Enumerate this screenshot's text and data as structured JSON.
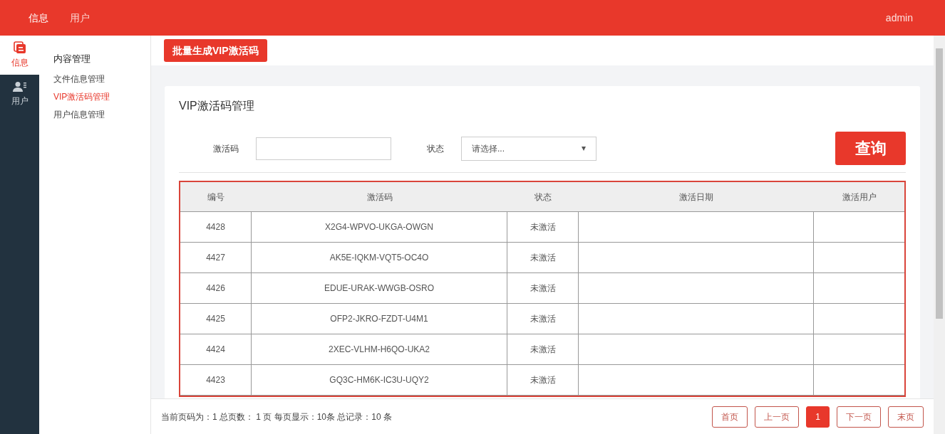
{
  "top_nav": [
    {
      "label": "信息",
      "selected": true
    },
    {
      "label": "用户",
      "selected": false
    }
  ],
  "user": "admin",
  "rail": [
    {
      "label": "信息",
      "kind": "doc",
      "selected": true
    },
    {
      "label": "用户",
      "kind": "user",
      "selected": false
    }
  ],
  "sidebar": {
    "heading": "内容管理",
    "items": [
      {
        "label": "文件信息管理",
        "selected": false
      },
      {
        "label": "VIP激活码管理",
        "selected": true
      },
      {
        "label": "用户信息管理",
        "selected": false
      }
    ]
  },
  "toolbar_button": "批量生成VIP激活码",
  "card_title": "VIP激活码管理",
  "filters": {
    "code_label": "激活码",
    "status_label": "状态",
    "status_placeholder": "请选择...",
    "query_button": "查询"
  },
  "table": {
    "columns": [
      "编号",
      "激活码",
      "状态",
      "激活日期",
      "激活用户"
    ],
    "rows": [
      [
        "4428",
        "X2G4-WPVO-UKGA-OWGN",
        "未激活"
      ],
      [
        "4427",
        "AK5E-IQKM-VQT5-OC4O",
        "未激活"
      ],
      [
        "4426",
        "EDUE-URAK-WWGB-OSRO",
        "未激活"
      ],
      [
        "4425",
        "OFP2-JKRO-FZDT-U4M1",
        "未激活"
      ],
      [
        "4424",
        "2XEC-VLHM-H6QO-UKA2",
        "未激活"
      ],
      [
        "4423",
        "GQ3C-HM6K-IC3U-UQY2",
        "未激活"
      ]
    ]
  },
  "footer": {
    "summary": "当前页码为：1 总页数： 1 页 每页显示：10条 总记录：10 条",
    "pages": [
      {
        "label": "首页",
        "selected": false
      },
      {
        "label": "上一页",
        "selected": false
      },
      {
        "label": "1",
        "selected": true
      },
      {
        "label": "下一页",
        "selected": false
      },
      {
        "label": "末页",
        "selected": false
      }
    ]
  }
}
